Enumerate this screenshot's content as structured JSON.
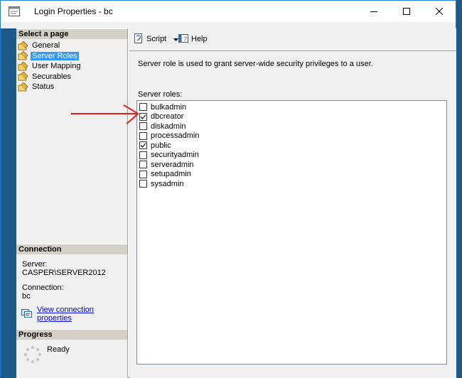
{
  "window": {
    "title": "Login Properties - bc"
  },
  "select_page": {
    "header": "Select a page",
    "items": [
      {
        "label": "General",
        "selected": false
      },
      {
        "label": "Server Roles",
        "selected": true
      },
      {
        "label": "User Mapping",
        "selected": false
      },
      {
        "label": "Securables",
        "selected": false
      },
      {
        "label": "Status",
        "selected": false
      }
    ]
  },
  "connection": {
    "header": "Connection",
    "server_label": "Server:",
    "server_value": "CASPER\\SERVER2012",
    "connection_label": "Connection:",
    "connection_value": "bc",
    "view_link": "View connection properties"
  },
  "progress": {
    "header": "Progress",
    "status": "Ready"
  },
  "toolbar": {
    "script_label": "Script",
    "help_label": "Help"
  },
  "main": {
    "description": "Server role is used to grant server-wide security privileges to a user.",
    "roles_label": "Server roles:",
    "roles": [
      {
        "name": "bulkadmin",
        "checked": false
      },
      {
        "name": "dbcreator",
        "checked": true
      },
      {
        "name": "diskadmin",
        "checked": false
      },
      {
        "name": "processadmin",
        "checked": false
      },
      {
        "name": "public",
        "checked": true
      },
      {
        "name": "securityadmin",
        "checked": false
      },
      {
        "name": "serveradmin",
        "checked": false
      },
      {
        "name": "setupadmin",
        "checked": false
      },
      {
        "name": "sysadmin",
        "checked": false
      }
    ]
  },
  "colors": {
    "selection": "#3399ff",
    "link": "#0000ee",
    "annotation_arrow": "#e02020",
    "window_border": "#1883d7"
  }
}
